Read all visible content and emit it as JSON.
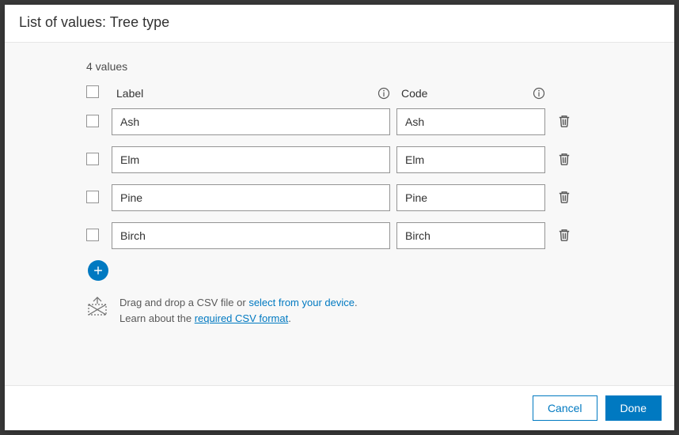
{
  "dialog": {
    "title": "List of values: Tree type"
  },
  "summary": {
    "count_text": "4 values"
  },
  "columns": {
    "label": "Label",
    "code": "Code"
  },
  "rows": [
    {
      "label": "Ash",
      "code": "Ash"
    },
    {
      "label": "Elm",
      "code": "Elm"
    },
    {
      "label": "Pine",
      "code": "Pine"
    },
    {
      "label": "Birch",
      "code": "Birch"
    }
  ],
  "csv": {
    "prefix": "Drag and drop a CSV file or ",
    "select_link": "select from your device",
    "suffix": ".",
    "learn_prefix": "Learn about the ",
    "format_link": "required CSV format",
    "learn_suffix": "."
  },
  "footer": {
    "cancel": "Cancel",
    "done": "Done"
  }
}
